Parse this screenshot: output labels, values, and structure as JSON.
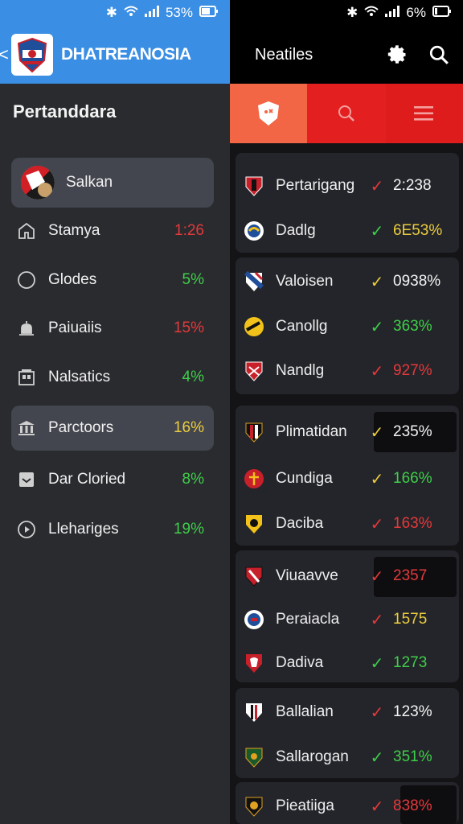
{
  "left": {
    "status": {
      "battery": "53%"
    },
    "header": {
      "title": "DHATREANOSIA",
      "back": "<"
    },
    "section_title": "Pertanddara",
    "nav": [
      {
        "label": "Salkan",
        "value": "",
        "color": "",
        "icon": "avatar-flag"
      },
      {
        "label": "Stamya",
        "value": "1:26",
        "color": "#e3393b",
        "icon": "home-icon"
      },
      {
        "label": "Glodes",
        "value": "5%",
        "color": "#3fce4a",
        "icon": "circle-icon"
      },
      {
        "label": "Paiuaiis",
        "value": "15%",
        "color": "#e3393b",
        "icon": "bell-icon"
      },
      {
        "label": "Nalsatics",
        "value": "4%",
        "color": "#3fce4a",
        "icon": "building-icon"
      },
      {
        "label": "Parctoors",
        "value": "16%",
        "color": "#eccd3f",
        "icon": "bank-icon"
      },
      {
        "label": "Dar Cloried",
        "value": "8%",
        "color": "#3fce4a",
        "icon": "inbox-icon"
      },
      {
        "label": "Llehariges",
        "value": "19%",
        "color": "#3fce4a",
        "icon": "play-circle-icon"
      }
    ]
  },
  "right": {
    "status": {
      "battery": "6%"
    },
    "header": {
      "title": "Neatiles"
    },
    "rows": [
      {
        "name": "Pertarigang",
        "check": "#e3393b",
        "value": "2:238",
        "value_color": "#f4f4f4"
      },
      {
        "name": "Dadlg",
        "check": "#3fce4a",
        "value": "6E53%",
        "value_color": "#eccd3f"
      },
      {
        "name": "Valoisen",
        "check": "#eccd3f",
        "value": "0938%",
        "value_color": "#f4f4f4"
      },
      {
        "name": "Canollg",
        "check": "#3fce4a",
        "value": "363%",
        "value_color": "#3fce4a"
      },
      {
        "name": "Nandlg",
        "check": "#e3393b",
        "value": "927%",
        "value_color": "#e3393b"
      },
      {
        "name": "Plimatidan",
        "check": "#eccd3f",
        "value": "235%",
        "value_color": "#f4f4f4"
      },
      {
        "name": "Cundiga",
        "check": "#eccd3f",
        "value": "166%",
        "value_color": "#3fce4a"
      },
      {
        "name": "Daciba",
        "check": "#e3393b",
        "value": "163%",
        "value_color": "#e3393b"
      },
      {
        "name": "Viuaavve",
        "check": "#e3393b",
        "value": "2357",
        "value_color": "#e3393b"
      },
      {
        "name": "Peraiacla",
        "check": "#e3393b",
        "value": "1575",
        "value_color": "#eccd3f"
      },
      {
        "name": "Dadiva",
        "check": "#3fce4a",
        "value": "1273",
        "value_color": "#3fce4a"
      },
      {
        "name": "Ballalian",
        "check": "#e3393b",
        "value": "123%",
        "value_color": "#f4f4f4"
      },
      {
        "name": "Sallarogan",
        "check": "#3fce4a",
        "value": "351%",
        "value_color": "#3fce4a"
      },
      {
        "name": "Pieatiiga",
        "check": "#e3393b",
        "value": "838%",
        "value_color": "#e3393b"
      }
    ]
  }
}
